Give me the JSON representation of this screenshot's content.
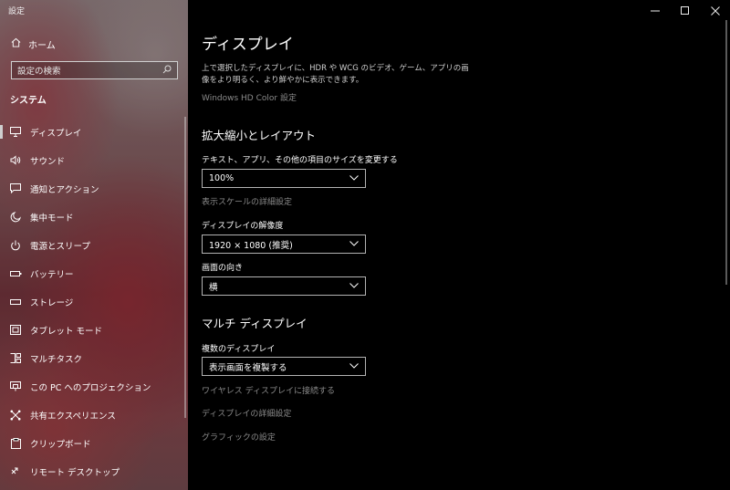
{
  "app": {
    "title": "設定"
  },
  "sidebar": {
    "home_label": "ホーム",
    "search_placeholder": "設定の検索",
    "section_title": "システム",
    "items": [
      {
        "label": "ディスプレイ",
        "icon": "monitor-icon"
      },
      {
        "label": "サウンド",
        "icon": "speaker-icon"
      },
      {
        "label": "通知とアクション",
        "icon": "notification-icon"
      },
      {
        "label": "集中モード",
        "icon": "moon-icon"
      },
      {
        "label": "電源とスリープ",
        "icon": "power-icon"
      },
      {
        "label": "バッテリー",
        "icon": "battery-icon"
      },
      {
        "label": "ストレージ",
        "icon": "storage-icon"
      },
      {
        "label": "タブレット モード",
        "icon": "tablet-icon"
      },
      {
        "label": "マルチタスク",
        "icon": "multitask-icon"
      },
      {
        "label": "この PC へのプロジェクション",
        "icon": "projection-icon"
      },
      {
        "label": "共有エクスペリエンス",
        "icon": "shared-experiences-icon"
      },
      {
        "label": "クリップボード",
        "icon": "clipboard-icon"
      },
      {
        "label": "リモート デスクトップ",
        "icon": "remote-desktop-icon"
      }
    ]
  },
  "main": {
    "title": "ディスプレイ",
    "description": "上で選択したディスプレイに、HDR や WCG のビデオ、ゲーム、アプリの画像をより明るく、より鮮やかに表示できます。",
    "hd_color_link": "Windows HD Color 設定",
    "scale_layout": {
      "heading": "拡大縮小とレイアウト",
      "scale_label": "テキスト、アプリ、その他の項目のサイズを変更する",
      "scale_value": "100%",
      "advanced_scale_link": "表示スケールの詳細設定",
      "resolution_label": "ディスプレイの解像度",
      "resolution_value": "1920 × 1080 (推奨)",
      "orientation_label": "画面の向き",
      "orientation_value": "横"
    },
    "multi_display": {
      "heading": "マルチ ディスプレイ",
      "multi_label": "複数のディスプレイ",
      "multi_value": "表示画面を複製する",
      "wireless_link": "ワイヤレス ディスプレイに接続する",
      "advanced_link": "ディスプレイの詳細設定",
      "graphics_link": "グラフィックの設定"
    }
  },
  "colors": {
    "background": "#000000",
    "link": "#8a8a8a",
    "accent": "#ffffff"
  }
}
